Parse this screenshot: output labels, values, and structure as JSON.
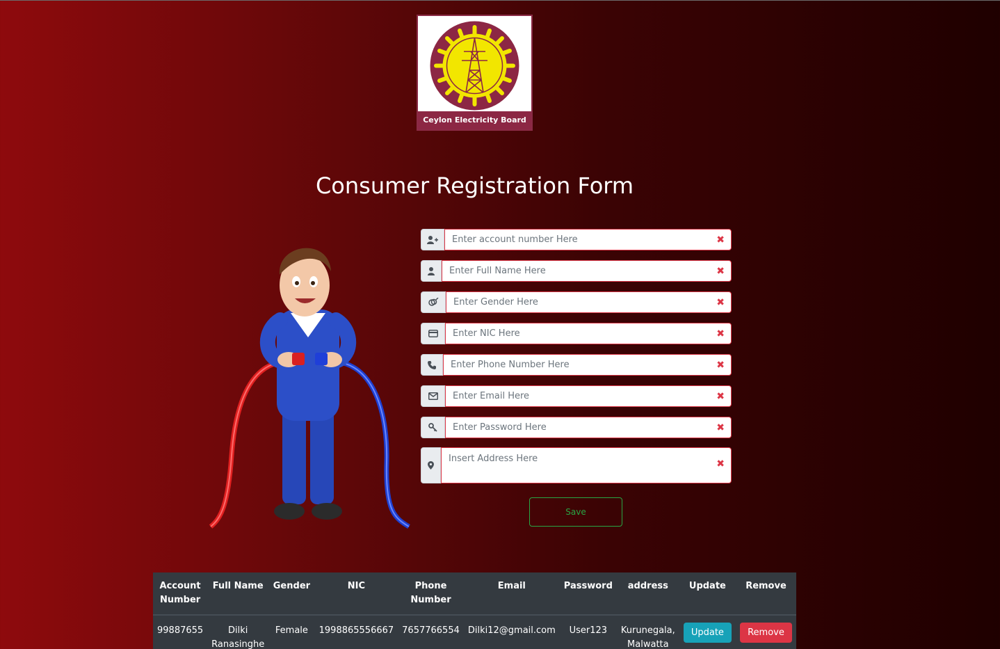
{
  "logo": {
    "org_name": "Ceylon Electricity Board"
  },
  "page_title": "Consumer Registration Form",
  "form": {
    "fields": [
      {
        "icon": "user-plus-icon",
        "placeholder": "Enter account number Here",
        "clear": "✖"
      },
      {
        "icon": "user-icon",
        "placeholder": "Enter Full Name Here",
        "clear": "✖"
      },
      {
        "icon": "gender-icon",
        "placeholder": "Enter Gender Here",
        "clear": "✖"
      },
      {
        "icon": "credit-card-icon",
        "placeholder": "Enter NIC Here",
        "clear": "✖"
      },
      {
        "icon": "phone-icon",
        "placeholder": "Enter Phone Number Here",
        "clear": "✖"
      },
      {
        "icon": "envelope-icon",
        "placeholder": "Enter Email Here",
        "clear": "✖"
      },
      {
        "icon": "key-icon",
        "placeholder": "Enter Password Here",
        "clear": "✖"
      },
      {
        "icon": "map-pin-icon",
        "placeholder": "Insert Address Here",
        "clear": "✖"
      }
    ],
    "save_label": "Save"
  },
  "table": {
    "headers": [
      "Account Number",
      "Full Name",
      "Gender",
      "NIC",
      "Phone Number",
      "Email",
      "Password",
      "address",
      "Update",
      "Remove"
    ],
    "rows": [
      {
        "account": "99887655",
        "name": "Dilki Ranasinghe",
        "gender": "Female",
        "nic": "1998865556667",
        "phone": "7657766554",
        "email": "Dilki12@gmail.com",
        "password": "User123",
        "address": "Kurunegala, Malwatta",
        "update_label": "Update",
        "remove_label": "Remove"
      }
    ]
  },
  "colors": {
    "danger": "#dc3545",
    "success": "#28a745",
    "info": "#17a2b8",
    "table_bg": "#343a40"
  }
}
